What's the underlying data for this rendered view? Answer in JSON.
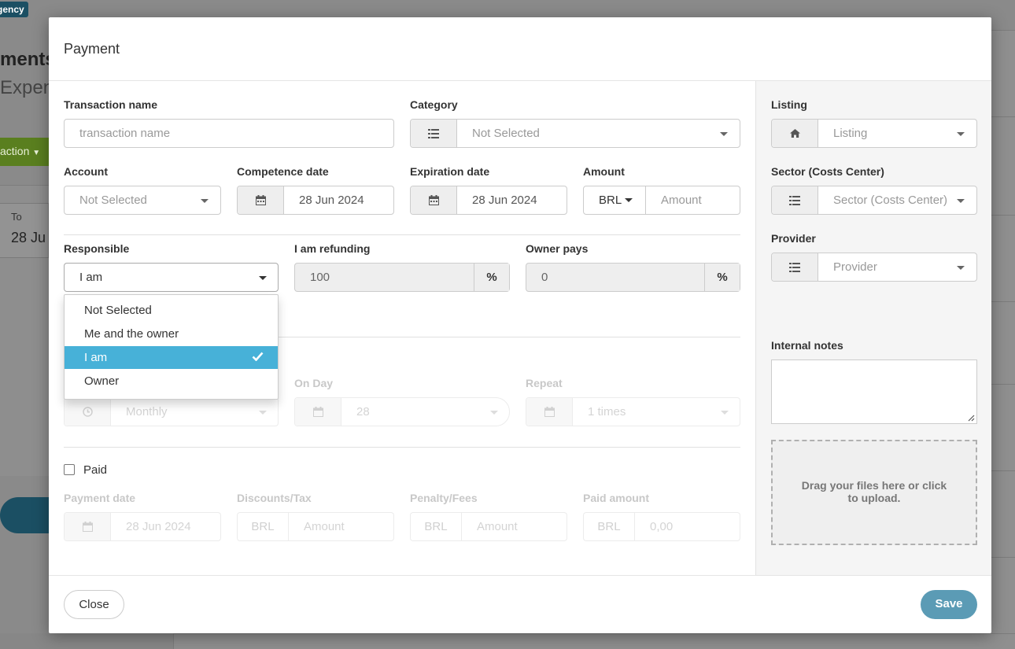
{
  "background": {
    "badge": "gency",
    "title": "ments",
    "subtitle": "Expens",
    "action_button": "action",
    "to_label": "To",
    "to_value": "28 Ju"
  },
  "modal": {
    "title": "Payment",
    "transaction_name": {
      "label": "Transaction name",
      "placeholder": "transaction name"
    },
    "category": {
      "label": "Category",
      "value": "Not Selected"
    },
    "account": {
      "label": "Account",
      "value": "Not Selected"
    },
    "competence_date": {
      "label": "Competence date",
      "value": "28 Jun 2024"
    },
    "expiration_date": {
      "label": "Expiration date",
      "value": "28 Jun 2024"
    },
    "amount": {
      "label": "Amount",
      "currency": "BRL",
      "placeholder": "Amount"
    },
    "responsible": {
      "label": "Responsible",
      "value": "I am",
      "options": [
        {
          "label": "Not Selected",
          "selected": false
        },
        {
          "label": "Me and the owner",
          "selected": false
        },
        {
          "label": "I am",
          "selected": true
        },
        {
          "label": "Owner",
          "selected": false
        }
      ]
    },
    "refunding": {
      "label": "I am refunding",
      "value": "100",
      "unit": "%"
    },
    "owner_pays": {
      "label": "Owner pays",
      "value": "0",
      "unit": "%"
    },
    "recurrence": {
      "frequency": "Monthly",
      "on_day": {
        "label": "On Day",
        "value": "28"
      },
      "repeat": {
        "label": "Repeat",
        "value": "1 times"
      }
    },
    "paid": {
      "label": "Paid",
      "checked": false
    },
    "payment_date": {
      "label": "Payment date",
      "value": "28 Jun 2024"
    },
    "discounts": {
      "label": "Discounts/Tax",
      "currency": "BRL",
      "placeholder": "Amount"
    },
    "penalty": {
      "label": "Penalty/Fees",
      "currency": "BRL",
      "placeholder": "Amount"
    },
    "paid_amount": {
      "label": "Paid amount",
      "currency": "BRL",
      "value": "0,00"
    },
    "listing": {
      "label": "Listing",
      "placeholder": "Listing"
    },
    "sector": {
      "label": "Sector (Costs Center)",
      "placeholder": "Sector (Costs Center)"
    },
    "provider": {
      "label": "Provider",
      "placeholder": "Provider"
    },
    "internal_notes": {
      "label": "Internal notes",
      "value": ""
    },
    "upload_text": "Drag your files here or click to upload.",
    "close_label": "Close",
    "save_label": "Save"
  },
  "colors": {
    "selected_option": "#47b1d8",
    "save_button": "#5b9bb5",
    "side_panel": "#f5f5f5"
  }
}
